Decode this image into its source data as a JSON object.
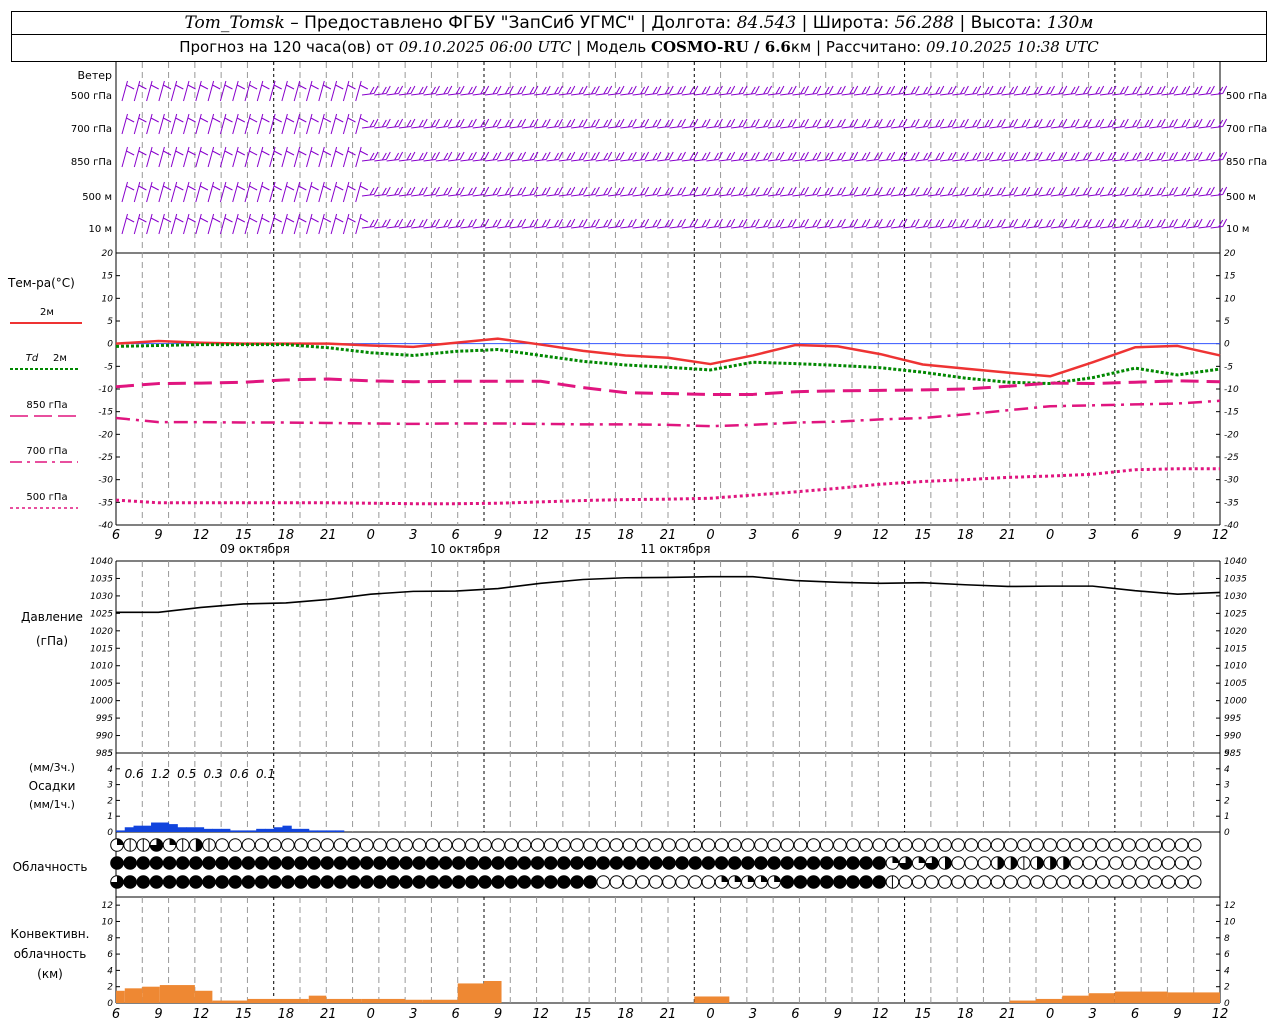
{
  "header": {
    "station": "Tom_Tomsk",
    "dash": "–",
    "provider": "Предоставлено ФГБУ \"ЗапСиб УГМС\"",
    "lon_label": "Долгота:",
    "lon": "84.543",
    "lat_label": "Широта:",
    "lat": "56.288",
    "alt_label": "Высота:",
    "alt": "130м",
    "forecast_prefix": "Прогноз на 120 часа(ов) от",
    "forecast_time": "09.10.2025 06:00 UTC",
    "model_label": "Модель",
    "model": "COSMO-RU / 6.6",
    "model_unit": "км",
    "calc_label": "Рассчитано:",
    "calc_time": "09.10.2025 10:38 UTC"
  },
  "colors": {
    "wind": "#8800cc",
    "t2m": "#ee3333",
    "td2m": "#008800",
    "t850": "#e0157f",
    "t700": "#e0157f",
    "t500": "#e0157f",
    "zero_line": "#3355ff",
    "pressure": "#000000",
    "precip": "#1144dd",
    "conv_cloud": "#ee8833",
    "grid": "#999999"
  },
  "time_axis": {
    "hour_labels": [
      "6",
      "9",
      "12",
      "15",
      "18",
      "21",
      "0",
      "3",
      "6",
      "9",
      "12",
      "15",
      "18",
      "21",
      "0",
      "3",
      "6",
      "9",
      "12",
      "15",
      "18",
      "21",
      "0",
      "3",
      "6",
      "9",
      "12"
    ],
    "day_labels": [
      "09 октября",
      "10 октября",
      "11 октября"
    ]
  },
  "wind_panel": {
    "title": "Ветер",
    "levels": [
      "500 гПа",
      "700 гПа",
      "850 гПа",
      "500 м",
      "10  м"
    ]
  },
  "chart_data": [
    {
      "type": "line",
      "title": "Тем-ра(°С)",
      "x": [
        "09.10 06",
        "09.10 09",
        "09.10 12",
        "09.10 15",
        "09.10 18",
        "09.10 21",
        "10.10 00",
        "10.10 03",
        "10.10 06",
        "10.10 09",
        "10.10 12",
        "10.10 15",
        "10.10 18",
        "10.10 21",
        "11.10 00",
        "11.10 03",
        "11.10 06",
        "11.10 09",
        "11.10 12",
        "11.10 15",
        "11.10 18",
        "11.10 21",
        "12.10 00",
        "12.10 03",
        "12.10 06",
        "12.10 09",
        "12.10 12"
      ],
      "ylim": [
        -40,
        20
      ],
      "yticks": [
        20,
        15,
        10,
        5,
        0,
        -5,
        -10,
        -15,
        -20,
        -25,
        -30,
        -35,
        -40
      ],
      "series": [
        {
          "name": "2м",
          "values": [
            0,
            0.6,
            0.2,
            0,
            0,
            0,
            -0.4,
            -0.7,
            0.2,
            1.1,
            -0.2,
            -1.6,
            -2.6,
            -3.1,
            -4.5,
            -2.6,
            -0.3,
            -0.6,
            -2.3,
            -4.6,
            -5.5,
            -6.4,
            -7.2,
            -4.1,
            -0.8,
            -0.5,
            -2.6
          ]
        },
        {
          "name": "Td  2м",
          "values": [
            -0.6,
            -0.4,
            -0.2,
            -0.2,
            -0.2,
            -0.9,
            -2.0,
            -2.6,
            -1.7,
            -1.3,
            -2.6,
            -3.9,
            -4.7,
            -5.2,
            -5.8,
            -4.1,
            -4.4,
            -4.8,
            -5.3,
            -6.3,
            -7.6,
            -8.5,
            -8.8,
            -7.5,
            -5.4,
            -6.9,
            -5.6
          ]
        },
        {
          "name": "850 гПа",
          "values": [
            -9.5,
            -8.8,
            -8.7,
            -8.5,
            -8,
            -7.8,
            -8.2,
            -8.4,
            -8.3,
            -8.3,
            -8.3,
            -9.7,
            -10.8,
            -11,
            -11.2,
            -11.2,
            -10.6,
            -10.4,
            -10.3,
            -10.2,
            -10,
            -9.4,
            -8.7,
            -8.8,
            -8.5,
            -8.2,
            -8.4
          ]
        },
        {
          "name": "700 гПа",
          "values": [
            -16.4,
            -17.3,
            -17.3,
            -17.4,
            -17.4,
            -17.5,
            -17.6,
            -17.7,
            -17.6,
            -17.6,
            -17.7,
            -17.8,
            -17.8,
            -17.9,
            -18.2,
            -17.9,
            -17.4,
            -17.2,
            -16.7,
            -16.4,
            -15.6,
            -14.7,
            -13.8,
            -13.6,
            -13.4,
            -13.2,
            -12.6
          ]
        },
        {
          "name": "500 гПа",
          "values": [
            -34.5,
            -35.1,
            -35.1,
            -35.1,
            -35.1,
            -35.1,
            -35.2,
            -35.3,
            -35.3,
            -35.2,
            -34.9,
            -34.6,
            -34.4,
            -34.3,
            -34.1,
            -33.4,
            -32.7,
            -31.9,
            -31,
            -30.4,
            -30,
            -29.5,
            -29.2,
            -28.8,
            -27.8,
            -27.6,
            -27.6
          ]
        }
      ]
    },
    {
      "type": "line",
      "title": "Давление",
      "ylabel": "(гПа)",
      "ylim": [
        985,
        1040
      ],
      "yticks": [
        1040,
        1035,
        1030,
        1025,
        1020,
        1015,
        1010,
        1005,
        1000,
        995,
        990,
        985
      ],
      "series": [
        {
          "name": "Давление",
          "values": [
            1025.3,
            1025.3,
            1026.7,
            1027.7,
            1028,
            1029,
            1030.5,
            1031.3,
            1031.4,
            1032.1,
            1033.6,
            1034.7,
            1035.2,
            1035.3,
            1035.5,
            1035.5,
            1034.4,
            1033.9,
            1033.6,
            1033.8,
            1033.2,
            1032.7,
            1032.8,
            1032.8,
            1031.5,
            1030.5,
            1031
          ]
        }
      ]
    },
    {
      "type": "bar",
      "title": "Осадки",
      "ylabel": "(мм/1ч.)",
      "ylabel_top": "(мм/3ч.)",
      "ylim": [
        0,
        5
      ],
      "yticks": [
        5,
        4,
        3,
        2,
        1,
        0
      ],
      "three_hour_totals": [
        "0.6",
        "1.2",
        "0.5",
        "0.3",
        "0.6",
        "0.1"
      ],
      "hourly_values": [
        0.1,
        0.3,
        0.4,
        0.4,
        0.6,
        0.6,
        0.5,
        0.3,
        0.3,
        0.3,
        0.2,
        0.2,
        0.2,
        0.1,
        0.1,
        0.1,
        0.2,
        0.2,
        0.3,
        0.4,
        0.2,
        0.2,
        0.1,
        0.1,
        0.1,
        0.1
      ]
    },
    {
      "type": "bar",
      "title": "Конвективн. облачность",
      "ylabel": "(км)",
      "ylim": [
        0,
        13
      ],
      "yticks": [
        12,
        10,
        8,
        6,
        4,
        2,
        0
      ],
      "segments": [
        {
          "from_h": 0,
          "to_h": 1,
          "value": 1.5
        },
        {
          "from_h": 1,
          "to_h": 3,
          "value": 1.8
        },
        {
          "from_h": 3,
          "to_h": 5,
          "value": 2.0
        },
        {
          "from_h": 5,
          "to_h": 9,
          "value": 2.2
        },
        {
          "from_h": 9,
          "to_h": 11,
          "value": 1.5
        },
        {
          "from_h": 11,
          "to_h": 15,
          "value": 0.3
        },
        {
          "from_h": 15,
          "to_h": 22,
          "value": 0.5
        },
        {
          "from_h": 22,
          "to_h": 24,
          "value": 0.9
        },
        {
          "from_h": 24,
          "to_h": 28,
          "value": 0.5
        },
        {
          "from_h": 28,
          "to_h": 33,
          "value": 0.5
        },
        {
          "from_h": 33,
          "to_h": 35,
          "value": 0.4
        },
        {
          "from_h": 35,
          "to_h": 39,
          "value": 0.4
        },
        {
          "from_h": 39,
          "to_h": 42,
          "value": 2.4
        },
        {
          "from_h": 42,
          "to_h": 44,
          "value": 2.7
        },
        {
          "from_h": 66,
          "to_h": 70,
          "value": 0.8
        },
        {
          "from_h": 102,
          "to_h": 105,
          "value": 0.3
        },
        {
          "from_h": 105,
          "to_h": 108,
          "value": 0.5
        },
        {
          "from_h": 108,
          "to_h": 111,
          "value": 0.9
        },
        {
          "from_h": 111,
          "to_h": 114,
          "value": 1.2
        },
        {
          "from_h": 114,
          "to_h": 120,
          "value": 1.4
        },
        {
          "from_h": 120,
          "to_h": 126,
          "value": 1.3
        }
      ]
    }
  ],
  "temperature_legend": [
    "2м",
    "Td",
    "2м",
    "850 гПа",
    "700 гПа",
    "500 гПа"
  ],
  "cloud_panel": {
    "title": "Облачность",
    "rows": [
      "rlltrbhl....................................................................................................................",
      "fffffffffffffffffffffffffffffffffffffffffffffffffffffffffffrtrth...hhlhhh......................................................",
      "tffffffffffffffffffffffffffffffffffff.........rrrrrffffffffl......................................................................"
    ]
  }
}
